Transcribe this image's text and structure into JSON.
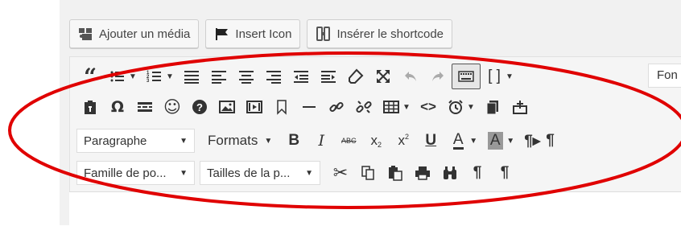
{
  "media_buttons": {
    "add_media": "Ajouter un média",
    "insert_icon": "Insert Icon",
    "insert_shortcode": "Insérer le shortcode"
  },
  "toolbar": {
    "row3": {
      "paragraph_select": "Paragraphe",
      "formats_label": "Formats"
    },
    "row4": {
      "font_family_select": "Famille de po...",
      "font_size_select": "Tailles de la p..."
    },
    "font_field_value": "Fon"
  },
  "annotation": {
    "ellipse_color": "#e00000"
  }
}
